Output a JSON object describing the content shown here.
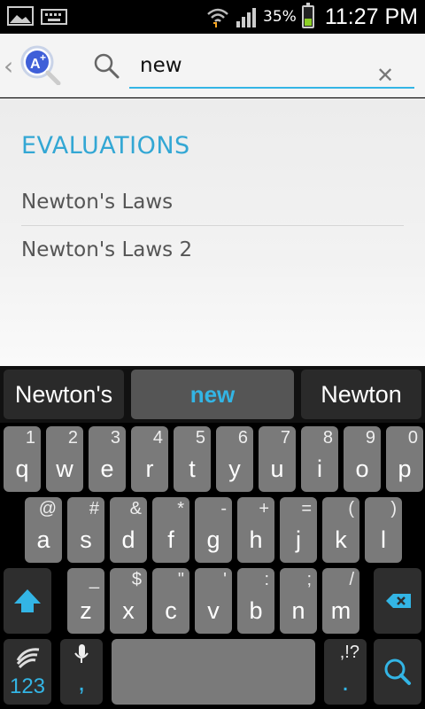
{
  "status_bar": {
    "battery_pct": "35%",
    "time": "11:27 PM",
    "icons": [
      "image-icon",
      "keyboard-icon",
      "wifi-icon",
      "signal-icon",
      "battery-icon"
    ]
  },
  "action_bar": {
    "search_value": "new"
  },
  "content": {
    "section_header": "EVALUATIONS",
    "results": [
      {
        "label": "Newton's Laws"
      },
      {
        "label": "Newton's Laws 2"
      }
    ]
  },
  "keyboard": {
    "suggestions": [
      "Newton's",
      "new",
      "Newton"
    ],
    "row1": [
      {
        "main": "q",
        "alt": "1"
      },
      {
        "main": "w",
        "alt": "2"
      },
      {
        "main": "e",
        "alt": "3"
      },
      {
        "main": "r",
        "alt": "4"
      },
      {
        "main": "t",
        "alt": "5"
      },
      {
        "main": "y",
        "alt": "6"
      },
      {
        "main": "u",
        "alt": "7"
      },
      {
        "main": "i",
        "alt": "8"
      },
      {
        "main": "o",
        "alt": "9"
      },
      {
        "main": "p",
        "alt": "0"
      }
    ],
    "row2": [
      {
        "main": "a",
        "alt": "@"
      },
      {
        "main": "s",
        "alt": "#"
      },
      {
        "main": "d",
        "alt": "&"
      },
      {
        "main": "f",
        "alt": "*"
      },
      {
        "main": "g",
        "alt": "-"
      },
      {
        "main": "h",
        "alt": "+"
      },
      {
        "main": "j",
        "alt": "="
      },
      {
        "main": "k",
        "alt": "("
      },
      {
        "main": "l",
        "alt": ")"
      }
    ],
    "row3": [
      {
        "main": "z",
        "alt": "_"
      },
      {
        "main": "x",
        "alt": "$"
      },
      {
        "main": "c",
        "alt": "\""
      },
      {
        "main": "v",
        "alt": "'"
      },
      {
        "main": "b",
        "alt": ":"
      },
      {
        "main": "n",
        "alt": ";"
      },
      {
        "main": "m",
        "alt": "/"
      }
    ],
    "numbers_label": "123",
    "comma_label": ",",
    "period_label": ".",
    "period_alt": ",!?",
    "accent_color": "#33b5e5"
  }
}
